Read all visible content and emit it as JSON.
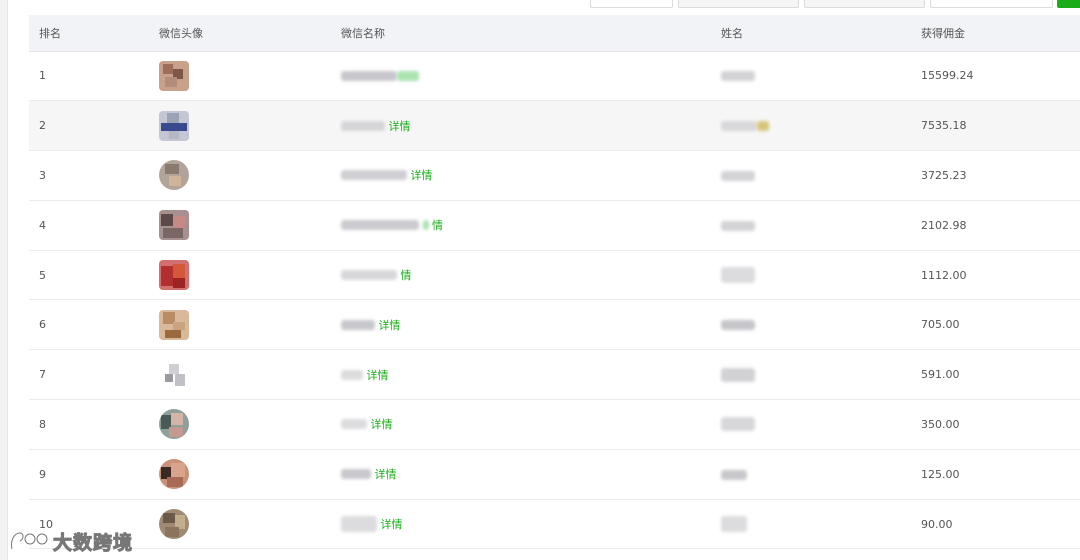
{
  "table": {
    "headers": {
      "rank": "排名",
      "avatar": "微信头像",
      "wechat_name": "微信名称",
      "real_name": "姓名",
      "commission": "获得佣金"
    },
    "detail_label": "详情",
    "rows": [
      {
        "rank": "1",
        "commission": "15599.24",
        "detail": ""
      },
      {
        "rank": "2",
        "commission": "7535.18",
        "detail": "详情"
      },
      {
        "rank": "3",
        "commission": "3725.23",
        "detail": "详情"
      },
      {
        "rank": "4",
        "commission": "2102.98",
        "detail": "情"
      },
      {
        "rank": "5",
        "commission": "1112.00",
        "detail": "情"
      },
      {
        "rank": "6",
        "commission": "705.00",
        "detail": "详情"
      },
      {
        "rank": "7",
        "commission": "591.00",
        "detail": "详情"
      },
      {
        "rank": "8",
        "commission": "350.00",
        "detail": "详情"
      },
      {
        "rank": "9",
        "commission": "125.00",
        "detail": "详情"
      },
      {
        "rank": "10",
        "commission": "90.00",
        "detail": "详情"
      }
    ]
  },
  "watermark": {
    "text": "大数跨境"
  },
  "colors": {
    "accent_green": "#1aad19",
    "header_bg": "#f2f3f7",
    "alt_row_bg": "#f6f6f6"
  }
}
